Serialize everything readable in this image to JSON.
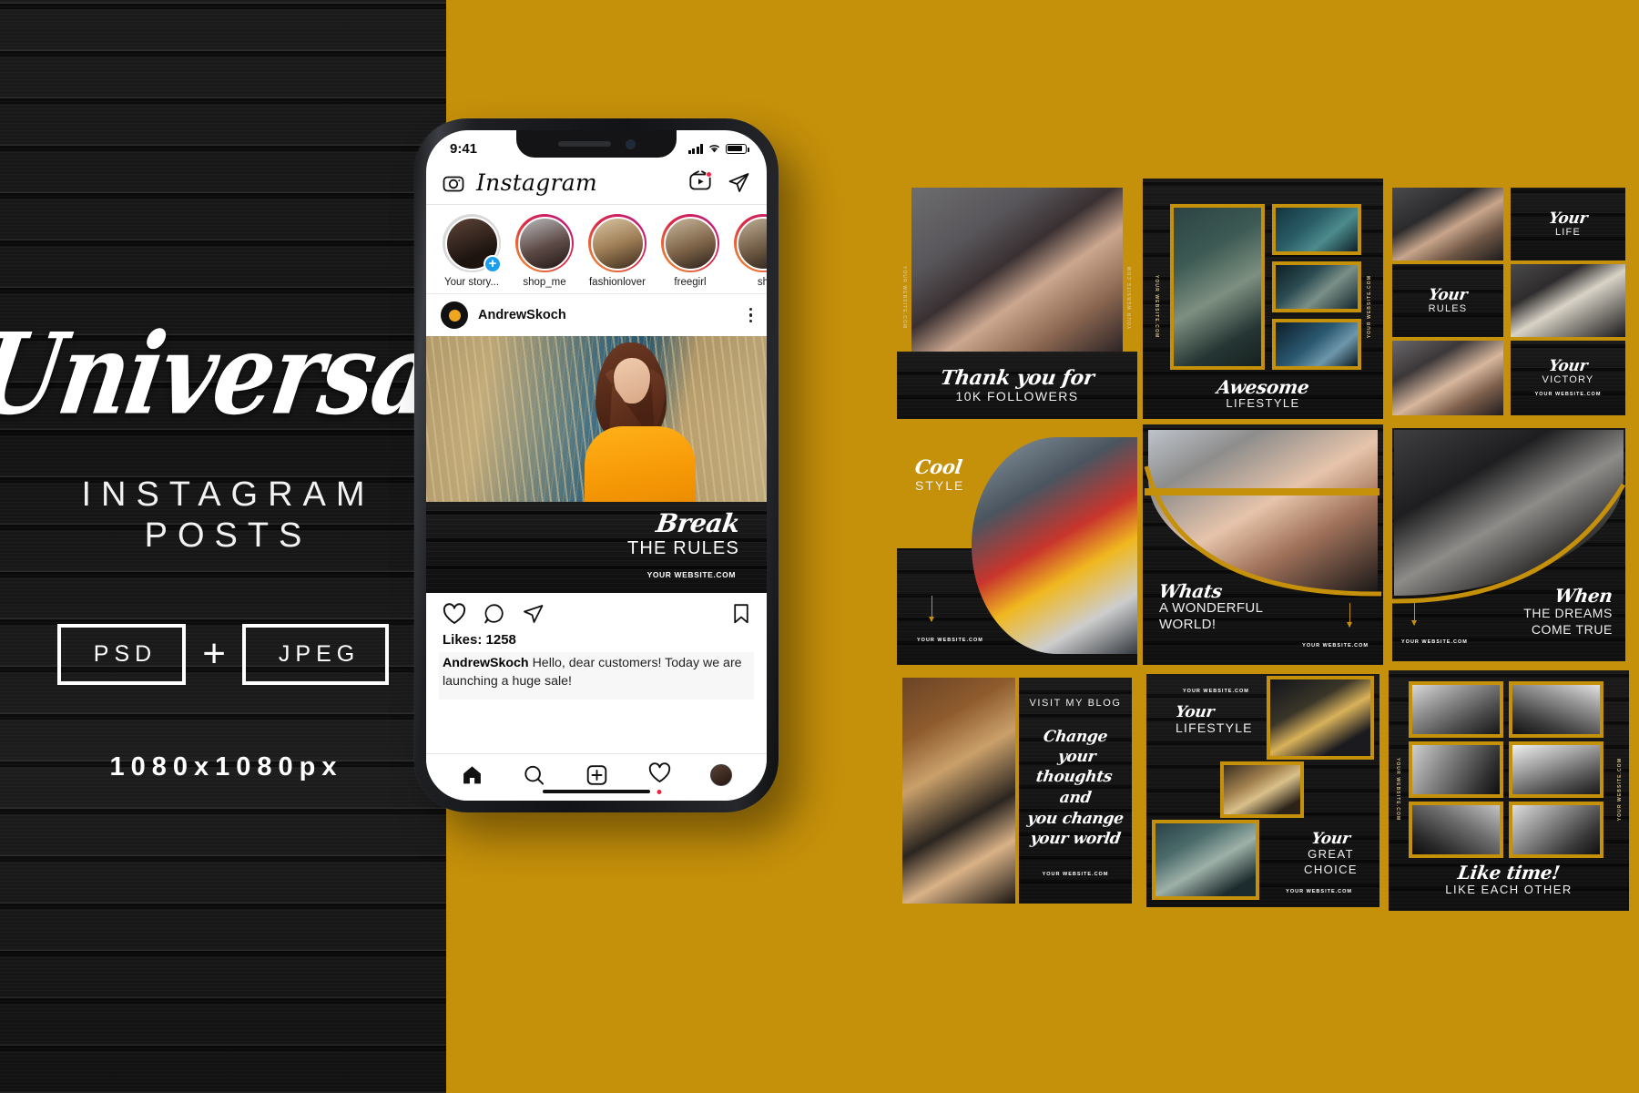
{
  "brand": {
    "title": "Universal",
    "subtitle_line1": "INSTAGRAM",
    "subtitle_line2": "POSTS",
    "format_psd": "PSD",
    "format_plus": "+",
    "format_jpeg": "JPEG",
    "dimensions": "1080x1080px",
    "accent_gold": "#c5900a",
    "panel_black": "#141414"
  },
  "phone": {
    "status": {
      "time": "9:41",
      "signal_icon": "signal-bars-icon",
      "wifi_icon": "wifi-icon",
      "battery_icon": "battery-icon"
    },
    "header": {
      "camera_icon": "camera-icon",
      "logo": "Instagram",
      "igtv_icon": "igtv-icon",
      "direct_icon": "paper-plane-icon"
    },
    "stories": [
      {
        "name": "Your story...",
        "has_ring": false,
        "has_plus": true
      },
      {
        "name": "shop_me",
        "has_ring": true,
        "has_plus": false
      },
      {
        "name": "fashionlover",
        "has_ring": true,
        "has_plus": false
      },
      {
        "name": "freegirl",
        "has_ring": true,
        "has_plus": false
      },
      {
        "name": "sh",
        "has_ring": true,
        "has_plus": false
      }
    ],
    "post": {
      "username": "AndrewSkoch",
      "menu_icon": "more-options-icon",
      "overlay_script": "Break",
      "overlay_sub": "THE RULES",
      "overlay_url": "YOUR WEBSITE.COM",
      "like_icon": "heart-icon",
      "comment_icon": "comment-icon",
      "share_icon": "paper-plane-icon",
      "save_icon": "bookmark-icon",
      "likes_label": "Likes: 1258",
      "caption_user": "AndrewSkoch",
      "caption_text": "Hello, dear customers! Today we are launching a huge sale!"
    },
    "tabbar": [
      {
        "icon": "home-icon",
        "active": true
      },
      {
        "icon": "search-icon",
        "active": false
      },
      {
        "icon": "add-post-icon",
        "active": false
      },
      {
        "icon": "activity-heart-icon",
        "active": false
      },
      {
        "icon": "profile-avatar-icon",
        "active": false
      }
    ]
  },
  "grid": {
    "url_text": "YOUR WEBSITE.COM",
    "tiles": [
      {
        "id": "thank-you",
        "script": "Thank you for",
        "sub": "10K FOLLOWERS",
        "url": "YOUR WEBSITE.COM"
      },
      {
        "id": "awesome-lifestyle",
        "script": "Awesome",
        "sub": "LIFESTYLE",
        "url": "YOUR WEBSITE.COM"
      },
      {
        "id": "your-life-rules-victory",
        "script": "Your",
        "sub1": "LIFE",
        "sub2": "RULES",
        "sub3": "VICTORY",
        "url": "YOUR WEBSITE.COM"
      },
      {
        "id": "cool-style",
        "script": "Cool",
        "sub": "STYLE",
        "url": "YOUR WEBSITE.COM"
      },
      {
        "id": "wonderful-world",
        "script": "Whats",
        "sub": "A WONDERFUL\nWORLD!",
        "sub_l1": "A WONDERFUL",
        "sub_l2": "WORLD!",
        "url": "YOUR WEBSITE.COM"
      },
      {
        "id": "dreams-come-true",
        "script": "When",
        "sub_l1": "THE DREAMS",
        "sub_l2": "COME TRUE",
        "url": "YOUR WEBSITE.COM"
      },
      {
        "id": "visit-my-blog",
        "heading": "VISIT MY BLOG",
        "quote_l1": "Change",
        "quote_l2": "your thoughts",
        "quote_l3": "and",
        "quote_l4": "you change",
        "quote_l5": "your world",
        "url": "YOUR WEBSITE.COM"
      },
      {
        "id": "your-lifestyle-choice",
        "script1": "Your",
        "sub1": "LIFESTYLE",
        "script2": "Your",
        "sub2_l1": "GREAT",
        "sub2_l2": "CHOICE",
        "url": "YOUR WEBSITE.COM"
      },
      {
        "id": "like-time",
        "script": "Like time!",
        "sub": "LIKE EACH OTHER",
        "url": "YOUR WEBSITE.COM"
      }
    ]
  }
}
